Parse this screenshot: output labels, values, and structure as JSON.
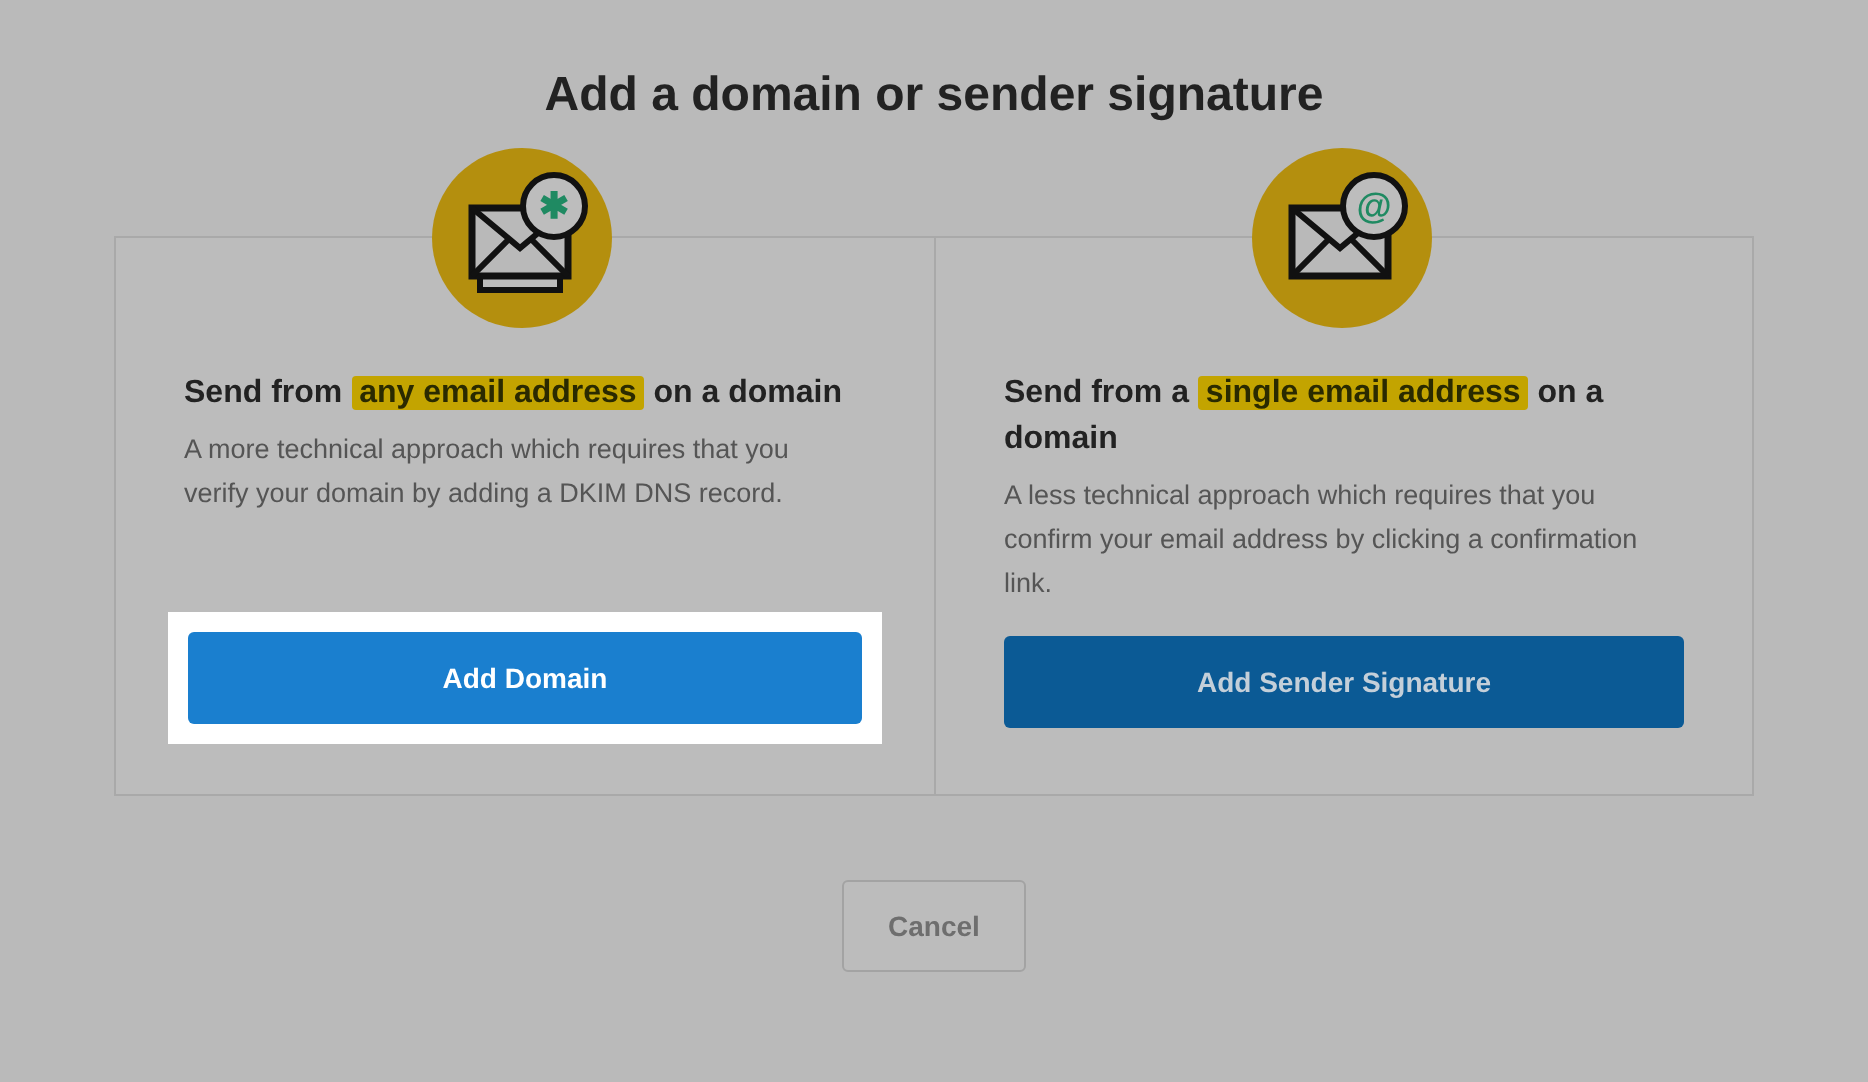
{
  "title": "Add a domain or sender signature",
  "options": [
    {
      "kind": "domain",
      "badge": "✱",
      "heading_before": "Send from",
      "highlight": "any email address",
      "heading_after": "on a domain",
      "description": "A more technical approach which requires that you verify your domain by adding a DKIM DNS record.",
      "button": "Add Domain",
      "focused": true
    },
    {
      "kind": "signature",
      "badge": "@",
      "heading_before": "Send from a",
      "highlight": "single email address",
      "heading_after": "on a domain",
      "description": "A less technical approach which requires that you confirm your email address by clicking a confirmation link.",
      "button": "Add Sender Signature",
      "focused": false
    }
  ],
  "cancel": "Cancel"
}
